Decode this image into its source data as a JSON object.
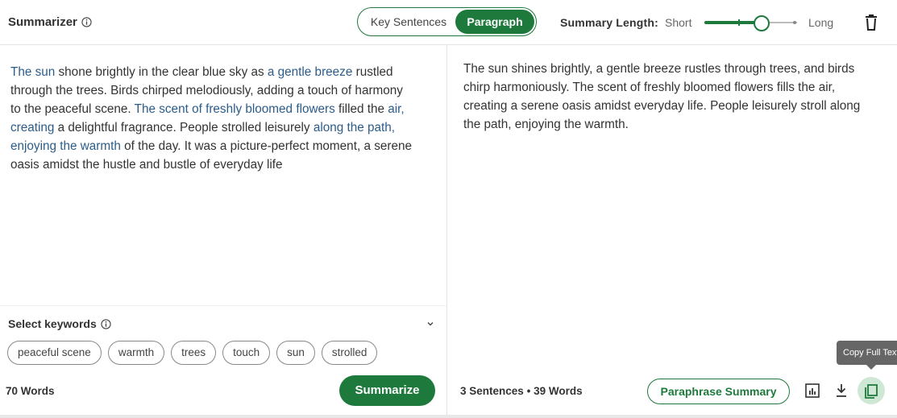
{
  "header": {
    "title": "Summarizer",
    "modes": [
      "Key Sentences",
      "Paragraph"
    ],
    "active_mode": "Paragraph",
    "length_label": "Summary Length:",
    "length_min_label": "Short",
    "length_max_label": "Long",
    "length_value_fraction": 0.64
  },
  "input": {
    "segments": [
      {
        "text": "The sun",
        "hl": true
      },
      {
        "text": " shone brightly in the clear blue sky as ",
        "hl": false
      },
      {
        "text": "a gentle breeze",
        "hl": true
      },
      {
        "text": " rustled through the trees. Birds chirped melodiously, adding a touch of harmony to the peaceful scene. ",
        "hl": false
      },
      {
        "text": "The scent of freshly bloomed flowers",
        "hl": true
      },
      {
        "text": " filled the ",
        "hl": false
      },
      {
        "text": "air, creating",
        "hl": true
      },
      {
        "text": " a delightful fragrance. People strolled leisurely ",
        "hl": false
      },
      {
        "text": "along the path, enjoying the warmth",
        "hl": true
      },
      {
        "text": " of the day. It was a picture-perfect moment, a serene oasis amidst the hustle and bustle of everyday life",
        "hl": false
      }
    ],
    "keywords_title": "Select keywords",
    "keywords": [
      "peaceful scene",
      "warmth",
      "trees",
      "touch",
      "sun",
      "strolled"
    ],
    "word_count": "70 Words",
    "summarize_label": "Summarize"
  },
  "output": {
    "text": "The sun shines brightly, a gentle breeze rustles through trees, and birds chirp harmoniously. The scent of freshly bloomed flowers fills the air, creating a serene oasis amidst everyday life. People leisurely stroll along the path, enjoying the warmth.",
    "sentences": "3 Sentences",
    "separator": "•",
    "words": "39 Words",
    "paraphrase_label": "Paraphrase Summary",
    "tooltip": "Copy Full Text"
  },
  "colors": {
    "accent": "#1e7a3c",
    "highlight": "#2b5c8a"
  }
}
